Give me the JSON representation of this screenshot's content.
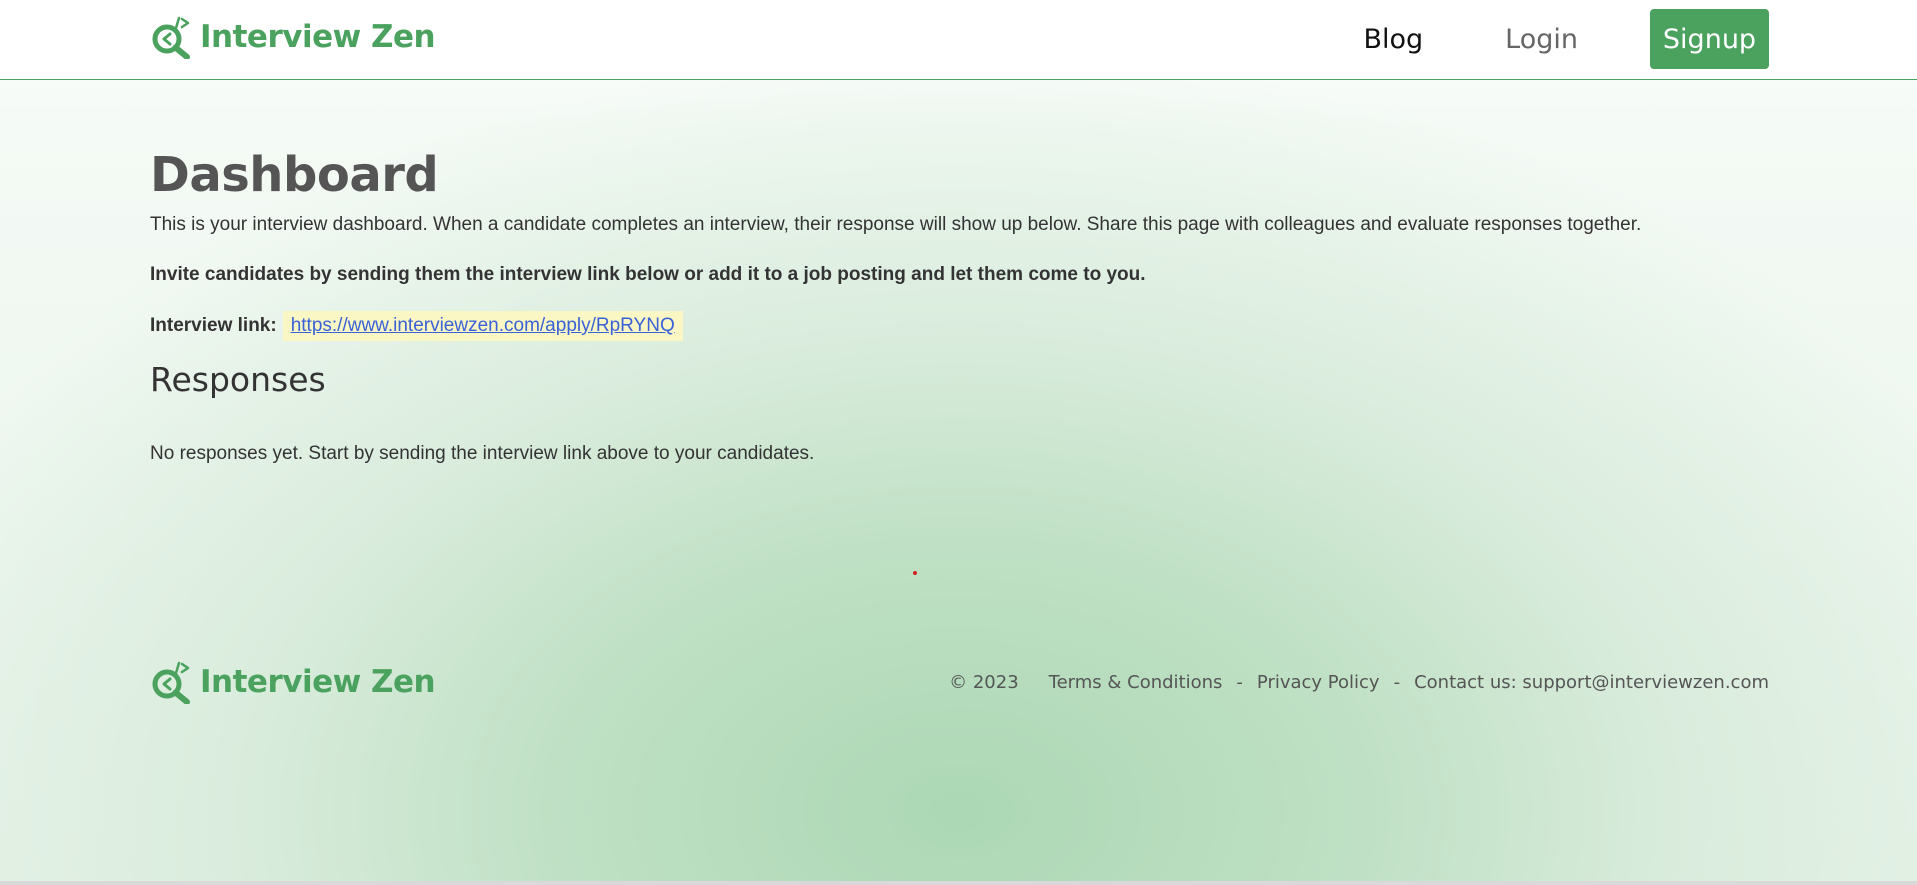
{
  "header": {
    "logo_text": "Interview Zen",
    "nav": {
      "blog": "Blog",
      "login": "Login",
      "signup": "Signup"
    }
  },
  "main": {
    "title": "Dashboard",
    "intro": "This is your interview dashboard. When a candidate completes an interview, their response will show up below. Share this page with colleagues and evaluate responses together.",
    "invite": "Invite candidates by sending them the interview link below or add it to a job posting and let them come to you.",
    "link_label": "Interview link:",
    "interview_link": "https://www.interviewzen.com/apply/RpRYNQ",
    "responses_title": "Responses",
    "no_responses": "No responses yet. Start by sending the interview link above to your candidates."
  },
  "footer": {
    "logo_text": "Interview Zen",
    "copyright": "© 2023",
    "terms": "Terms & Conditions",
    "separator": "-",
    "privacy": "Privacy Policy",
    "contact": "Contact us: support@interviewzen.com"
  },
  "colors": {
    "brand_green": "#4aa25e",
    "link_blue": "#3a62d8",
    "link_highlight": "#fbf7c4"
  },
  "icons": {
    "logo": "magnifier-code-icon"
  }
}
